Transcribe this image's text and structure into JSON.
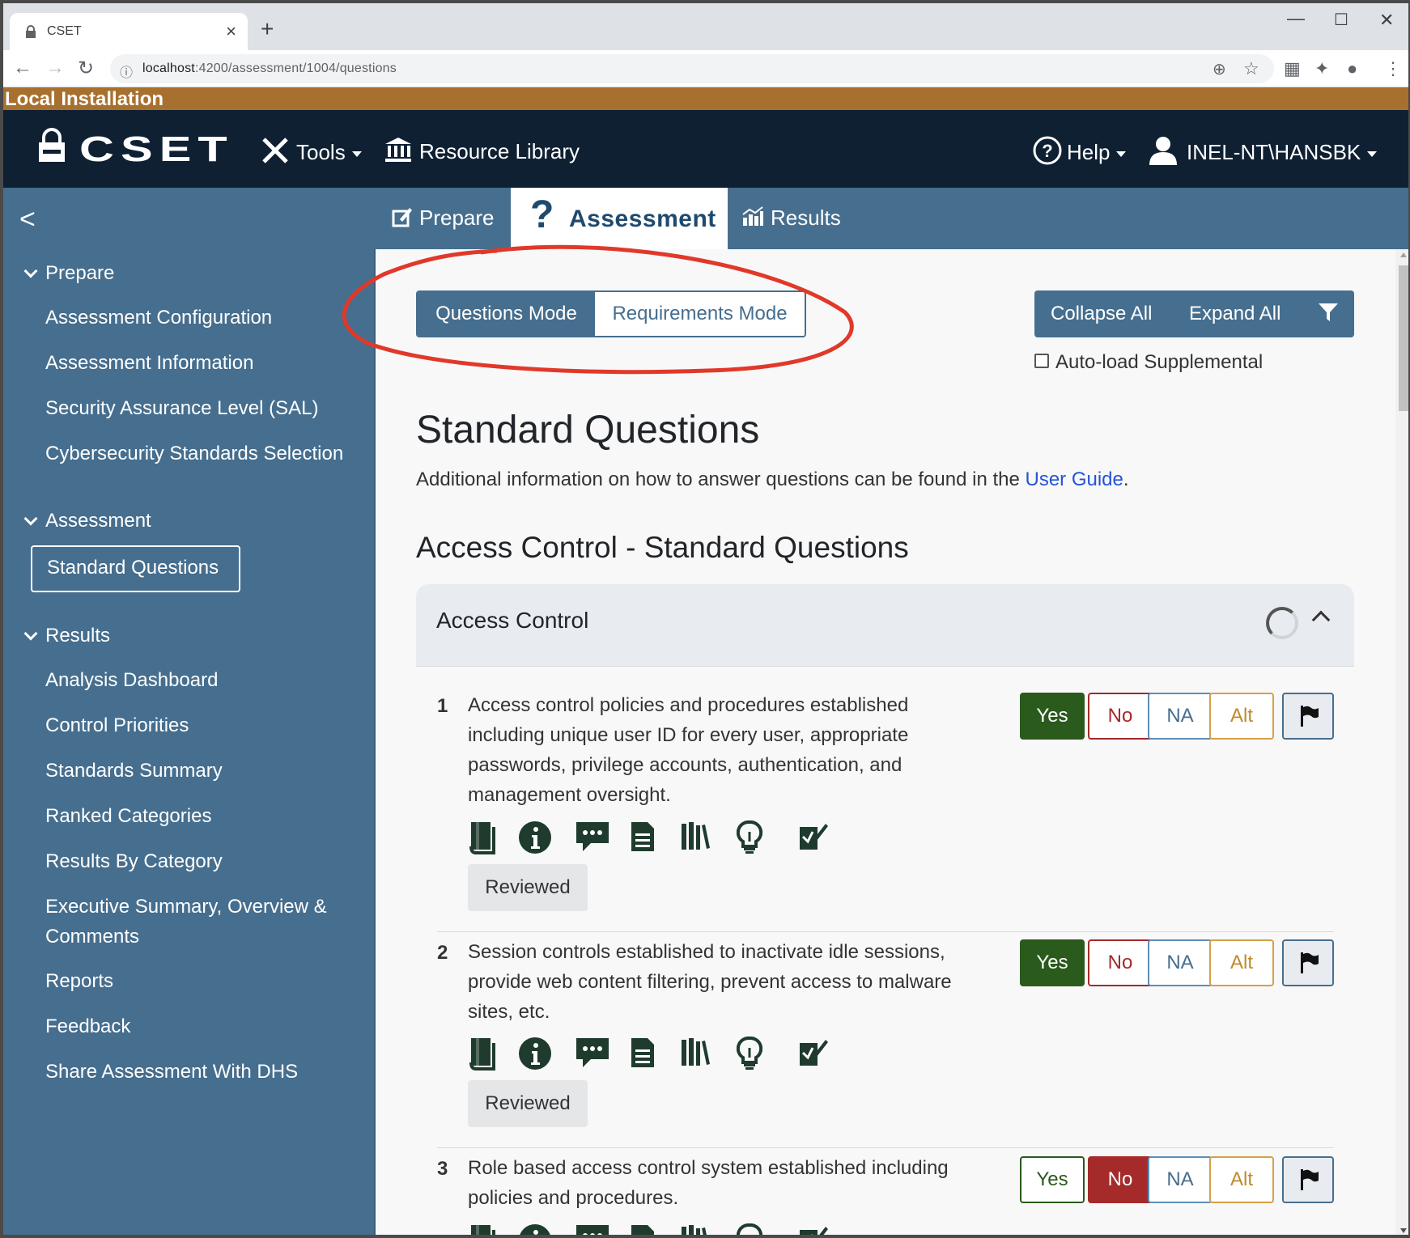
{
  "browser": {
    "tab_title": "CSET",
    "tab_close": "×",
    "new_tab": "+",
    "url_host": "localhost",
    "url_rest": ":4200/assessment/1004/questions",
    "window_controls": [
      "—",
      "☐",
      "✕"
    ]
  },
  "banner": {
    "text": "Local Installation"
  },
  "appnav": {
    "brand": "CSET",
    "tools": "Tools",
    "resource_library": "Resource Library",
    "help": "Help",
    "user": "INEL-NT\\HANSBK"
  },
  "subnav": {
    "prepare": "Prepare",
    "assessment": "Assessment",
    "results": "Results"
  },
  "sidebar": {
    "groups": [
      {
        "label": "Prepare",
        "items": [
          "Assessment Configuration",
          "Assessment Information",
          "Security Assurance Level (SAL)",
          "Cybersecurity Standards Selection"
        ]
      },
      {
        "label": "Assessment",
        "items": [
          "Standard Questions"
        ]
      },
      {
        "label": "Results",
        "items": [
          "Analysis Dashboard",
          "Control Priorities",
          "Standards Summary",
          "Ranked Categories",
          "Results By Category",
          "Executive Summary, Overview & Comments",
          "Reports",
          "Feedback",
          "Share Assessment With DHS"
        ]
      }
    ],
    "active_item": "Standard Questions"
  },
  "main": {
    "mode_questions": "Questions Mode",
    "mode_requirements": "Requirements Mode",
    "collapse_all": "Collapse All",
    "expand_all": "Expand All",
    "autoload": "Auto-load Supplemental",
    "title": "Standard Questions",
    "subtext_prefix": "Additional information on how to answer questions can be found in the ",
    "subtext_link": "User Guide",
    "subtext_suffix": ".",
    "section_title": "Access Control - Standard Questions",
    "category": "Access Control"
  },
  "answer_labels": {
    "yes": "Yes",
    "no": "No",
    "na": "NA",
    "alt": "Alt"
  },
  "reviewed_label": "Reviewed",
  "questions": [
    {
      "num": "1",
      "text": "Access control policies and procedures established including unique user ID for every user, appropriate passwords, privilege accounts, authentication, and management oversight.",
      "answer": "yes"
    },
    {
      "num": "2",
      "text": "Session controls established to inactivate idle sessions, provide web content filtering, prevent access to malware sites, etc.",
      "answer": "yes"
    },
    {
      "num": "3",
      "text": "Role based access control system established including policies and procedures.",
      "answer": "no"
    }
  ],
  "question_icons": [
    "book-icon",
    "info-icon",
    "comment-icon",
    "document-icon",
    "library-icon",
    "lightbulb-icon",
    "feedback-icon"
  ],
  "colors": {
    "nav_dark": "#0f2033",
    "nav_mid": "#466e8e",
    "banner": "#a8702e",
    "yes": "#2a5a1c",
    "no": "#a52a2a",
    "annotation": "#e0392a"
  }
}
